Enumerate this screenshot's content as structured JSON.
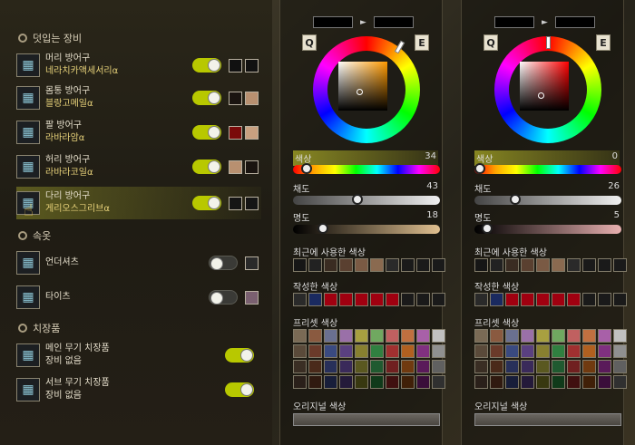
{
  "left": {
    "section_worn": "덧입는 장비",
    "section_inner": "속옷",
    "section_weapon": "치장품",
    "items": [
      {
        "name": "머리 방어구",
        "sub": "네라치카액세서리α",
        "toggle": "on",
        "c1": "#111111",
        "c2": "#111111"
      },
      {
        "name": "몸통 방어구",
        "sub": "블랑고메일α",
        "toggle": "on",
        "c1": "#1a1410",
        "c2": "#b89070"
      },
      {
        "name": "팔 방어구",
        "sub": "라바라암α",
        "toggle": "on",
        "c1": "#7a0a0a",
        "c2": "#c8a080"
      },
      {
        "name": "허리 방어구",
        "sub": "라바라코일α",
        "toggle": "on",
        "c1": "#b89070",
        "c2": "#1a1410"
      },
      {
        "name": "다리 방어구",
        "sub": "게리오스그리브α",
        "toggle": "on",
        "c1": "#151515",
        "c2": "#151515"
      }
    ],
    "inner": [
      {
        "name": "언더셔츠",
        "toggle": "off",
        "c1": "#2a2a2a"
      },
      {
        "name": "타이츠",
        "toggle": "off",
        "c1": "#7a6070"
      }
    ],
    "weapons": [
      {
        "name": "메인 무기 치장품",
        "sub": "장비 없음",
        "toggle": "on"
      },
      {
        "name": "서브 무기 치장품",
        "sub": "장비 없음",
        "toggle": "on"
      }
    ]
  },
  "panels": [
    {
      "q": "Q",
      "e": "E",
      "arrow": "►",
      "hue_label": "색상",
      "hue_value": "34",
      "sat_label": "채도",
      "sat_value": "43",
      "val_label": "명도",
      "val_value": "18",
      "recent_label": "최근에 사용한 색상",
      "created_label": "작성한 색상",
      "preset_label": "프리셋 색상",
      "original_label": "오리지널 색상",
      "hue_color": "#ff9a00",
      "recent": [
        "#161616",
        "#222",
        "#3a2c22",
        "#5a4030",
        "#7a5a44",
        "#8a6a50",
        "#2a2a2a",
        "#1a1a1a",
        "#1a1a1a",
        "#1a1a1a"
      ],
      "created": [
        "#2a2a2a",
        "#1a2a60",
        "#a00010",
        "#a00010",
        "#a00010",
        "#a00010",
        "#a00010",
        "#1a1a1a",
        "#1a1a1a",
        "#1a1a1a"
      ]
    },
    {
      "q": "Q",
      "e": "E",
      "arrow": "►",
      "hue_label": "색상",
      "hue_value": "0",
      "sat_label": "채도",
      "sat_value": "26",
      "val_label": "명도",
      "val_value": "5",
      "recent_label": "최근에 사용한 색상",
      "created_label": "작성한 색상",
      "preset_label": "프리셋 색상",
      "original_label": "오리지널 색상",
      "hue_color": "#ff0000",
      "recent": [
        "#161616",
        "#222",
        "#3a2c22",
        "#5a4030",
        "#7a5a44",
        "#8a6a50",
        "#2a2a2a",
        "#1a1a1a",
        "#1a1a1a",
        "#1a1a1a"
      ],
      "created": [
        "#2a2a2a",
        "#1a2a60",
        "#a00010",
        "#a00010",
        "#a00010",
        "#a00010",
        "#a00010",
        "#1a1a1a",
        "#1a1a1a",
        "#1a1a1a"
      ]
    }
  ],
  "preset_colors": [
    "#7a6a55",
    "#8a5a40",
    "#6a7090",
    "#9a70a8",
    "#a8a040",
    "#70a860",
    "#c06060",
    "#c07040",
    "#a860a8",
    "#c0c0c0",
    "#5a4a3a",
    "#6a3a2a",
    "#3a4a80",
    "#5a4080",
    "#888030",
    "#308040",
    "#a03030",
    "#b06020",
    "#803080",
    "#909090",
    "#3a2e24",
    "#4a2a1a",
    "#28305a",
    "#3a2a5a",
    "#5a5820",
    "#205a30",
    "#702020",
    "#703a10",
    "#5a1a5a",
    "#606060",
    "#2a201a",
    "#301a10",
    "#181e3a",
    "#241a3a",
    "#383810",
    "#103a1a",
    "#401010",
    "#402008",
    "#3a0e3a",
    "#303030"
  ]
}
